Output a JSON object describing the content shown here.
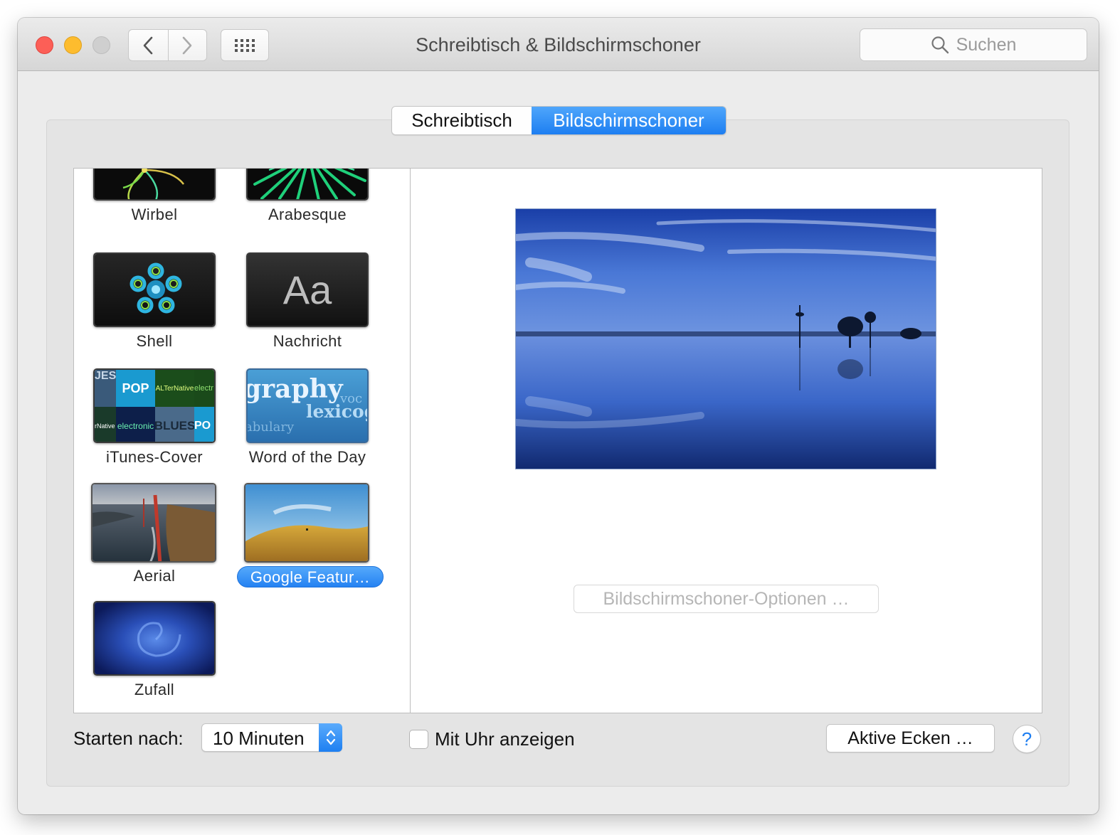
{
  "window": {
    "title": "Schreibtisch & Bildschirmschoner",
    "search_placeholder": "Suchen"
  },
  "toolbar": {
    "back_icon": "chevron-left-icon",
    "forward_icon": "chevron-right-icon",
    "show_all_icon": "grid-icon"
  },
  "tabs": [
    {
      "label": "Schreibtisch",
      "selected": false
    },
    {
      "label": "Bildschirmschoner",
      "selected": true
    }
  ],
  "savers": [
    {
      "label": "Wirbel"
    },
    {
      "label": "Arabesque"
    },
    {
      "label": "Shell"
    },
    {
      "label": "Nachricht",
      "thumb_text": "Aa"
    },
    {
      "label": "iTunes-Cover",
      "thumb_words": [
        "JES",
        "POP",
        "ALTerNative",
        "electr",
        "rNative",
        "electronic",
        "BLUES",
        "PO"
      ]
    },
    {
      "label": "Word of the Day",
      "thumb_words": [
        "graphy",
        "voc",
        "lexicog",
        "abulary"
      ]
    },
    {
      "label": "Aerial"
    },
    {
      "label": "Google Featur…",
      "selected": true
    },
    {
      "label": "Zufall"
    }
  ],
  "preview": {
    "options_button": "Bildschirmschoner-Optionen …"
  },
  "bottom": {
    "start_label": "Starten nach:",
    "start_value": "10 Minuten",
    "clock_label": "Mit Uhr anzeigen",
    "clock_checked": false,
    "corners_button": "Aktive Ecken …",
    "help_label": "?"
  },
  "colors": {
    "accent": "#1d7ef1",
    "close": "#fc5f57",
    "minimize": "#fdbc2e"
  }
}
